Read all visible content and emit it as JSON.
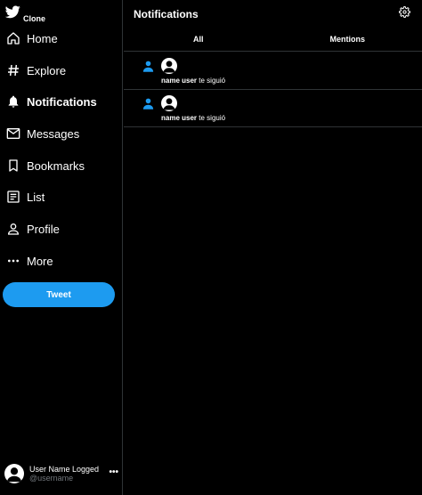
{
  "brand": {
    "name": "Clone",
    "color": "#1d9bf0"
  },
  "nav": [
    {
      "label": "Home",
      "icon": "home-icon"
    },
    {
      "label": "Explore",
      "icon": "hashtag-icon"
    },
    {
      "label": "Notifications",
      "icon": "bell-icon",
      "active": true
    },
    {
      "label": "Messages",
      "icon": "mail-icon"
    },
    {
      "label": "Bookmarks",
      "icon": "bookmark-icon"
    },
    {
      "label": "List",
      "icon": "list-icon"
    },
    {
      "label": "Profile",
      "icon": "person-icon"
    },
    {
      "label": "More",
      "icon": "more-icon"
    }
  ],
  "tweet_button": "Tweet",
  "user": {
    "name": "User Name Logged",
    "handle": "@username",
    "more": "•••"
  },
  "header": {
    "title": "Notifications"
  },
  "tabs": [
    {
      "label": "All"
    },
    {
      "label": "Mentions"
    }
  ],
  "notifications": [
    {
      "user": "name user",
      "action": "te siguió"
    },
    {
      "user": "name user",
      "action": "te siguió"
    }
  ]
}
